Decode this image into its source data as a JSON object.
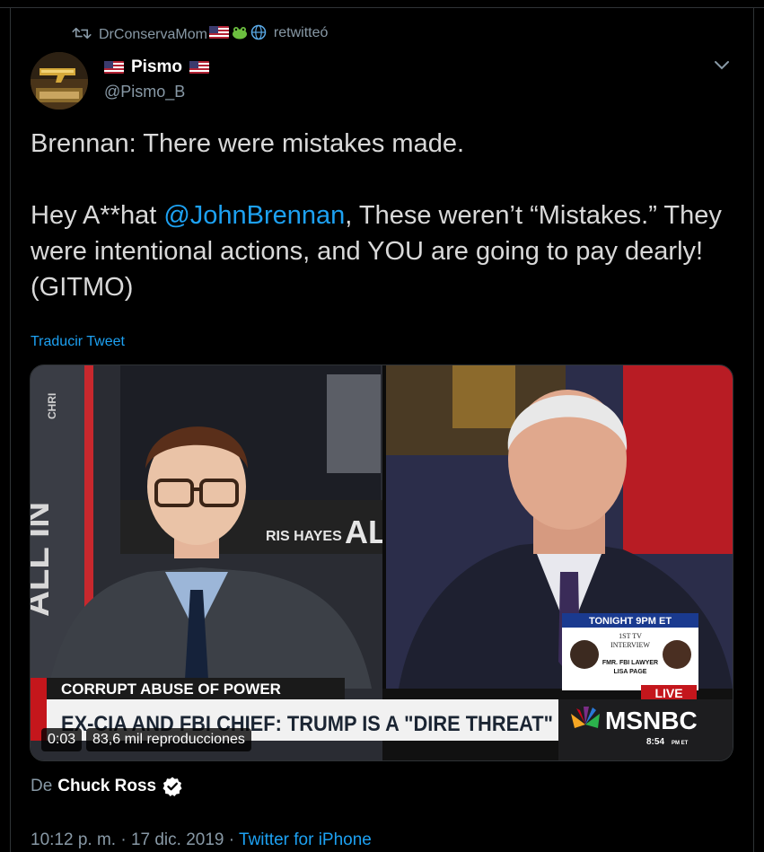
{
  "retweet": {
    "icon": "retweet-icon",
    "user": "DrConservaMom",
    "action": "retwitteó"
  },
  "author": {
    "name": "Pismo",
    "handle": "@Pismo_B",
    "avatar_icon": "avatar-gold-pistol"
  },
  "tweet": {
    "line1": "Brennan: There were mistakes made.",
    "line2_before": "Hey A**hat ",
    "mention": "@JohnBrennan",
    "line2_after": ", These weren’t “Mistakes.” They were intentional actions, and YOU are going to pay dearly! (GITMO)"
  },
  "translate_label": "Traducir Tweet",
  "video": {
    "time": "0:03",
    "views": "83,6 mil reproducciones",
    "chyron_top": "CORRUPT ABUSE OF POWER",
    "chyron_main": "EX-CIA AND FBI CHIEF: TRUMP IS A \"DIRE THREAT\"",
    "network": "MSNBC",
    "clock": "8:54",
    "clock_suffix": "PM ET",
    "live": "LIVE",
    "promo_title": "TONIGHT 9PM ET",
    "promo_line1": "1ST TV",
    "promo_line2": "INTERVIEW",
    "promo_line3": "FMR. FBI LAWYER",
    "promo_line4": "LISA PAGE",
    "wall_text_left": "ALL IN",
    "wall_text_mid": "RIS HAYES",
    "wall_text_mid2": "AL",
    "wall_text_small": "CHRI"
  },
  "source": {
    "prefix": "De",
    "name": "Chuck Ross"
  },
  "meta": {
    "time": "10:12 p. m. · 17 dic. 2019 · ",
    "app": "Twitter for iPhone"
  },
  "colors": {
    "accent": "#1da1f2",
    "secondary": "#8899a6",
    "text": "#d9d9d9",
    "background": "#000000",
    "msnbc_red": "#c4161c"
  }
}
